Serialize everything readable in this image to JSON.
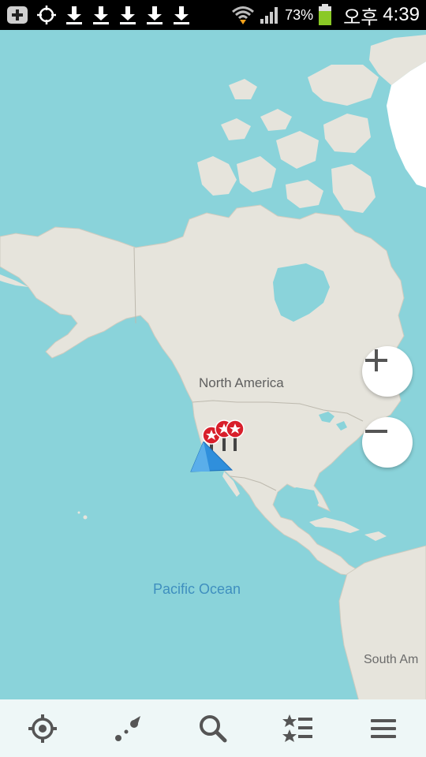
{
  "status_bar": {
    "battery": "73%",
    "ampm": "오후",
    "time": "4:39",
    "icons": [
      "add-notification-icon",
      "gps-icon",
      "download-icon",
      "download-icon",
      "download-icon",
      "download-icon",
      "download-icon",
      "wifi-icon",
      "signal-icon",
      "battery-icon"
    ]
  },
  "map": {
    "labels": {
      "north_america": "North America",
      "pacific_ocean": "Pacific Ocean",
      "south_america": "South Am"
    },
    "colors": {
      "water": "#8ad3da",
      "land": "#e6e4dc",
      "ice": "#ffffff",
      "pin": "#d81f2b",
      "location_arrow": "#2f8fdc"
    }
  },
  "zoom": {
    "in_icon": "plus-icon",
    "out_icon": "minus-icon"
  },
  "toolbar": {
    "icons": [
      "my-location-icon",
      "route-icon",
      "search-icon",
      "bookmarks-icon",
      "menu-icon"
    ]
  }
}
